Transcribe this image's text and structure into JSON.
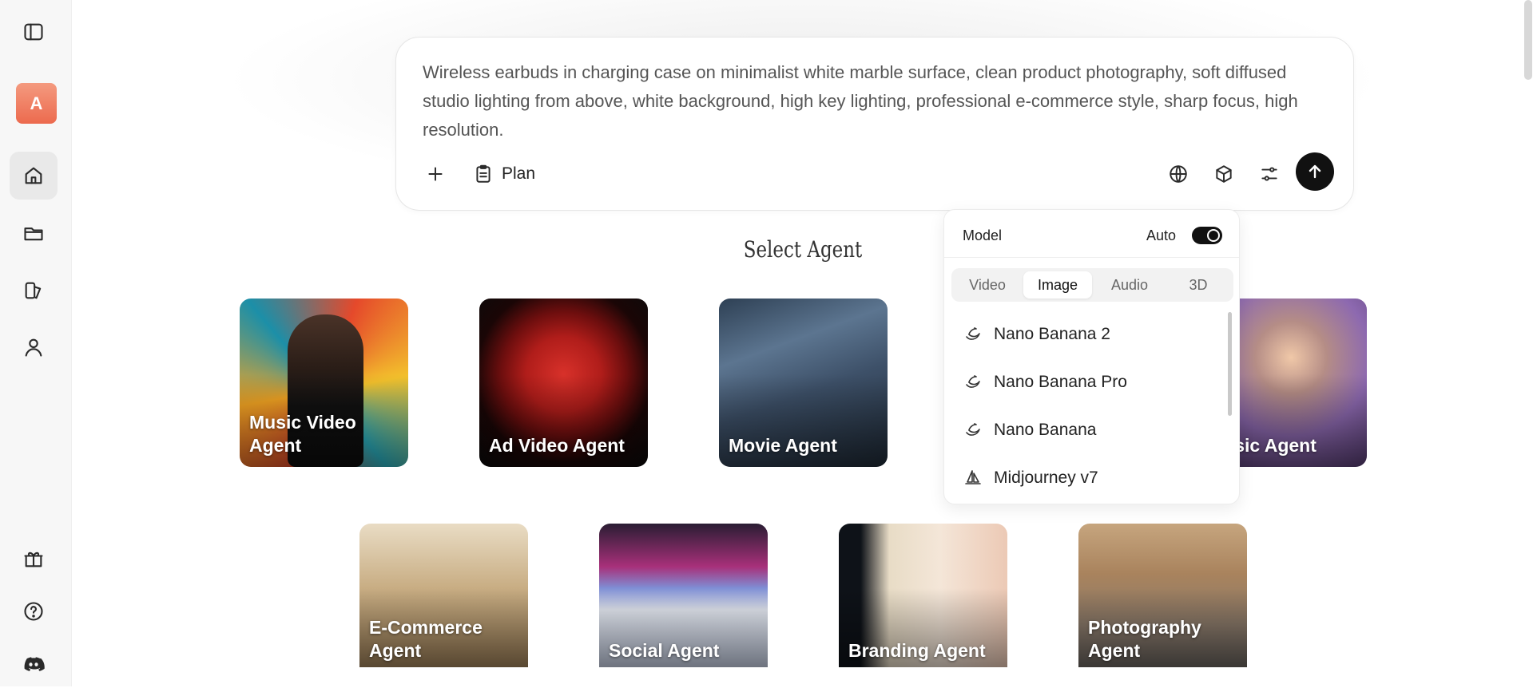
{
  "sidebar": {
    "avatar_letter": "A",
    "top_icons": [
      "sidebar-toggle-icon"
    ],
    "nav": [
      {
        "name": "home",
        "icon": "home-icon",
        "active": true
      },
      {
        "name": "projects",
        "icon": "folder-icon",
        "active": false
      },
      {
        "name": "library",
        "icon": "library-icon",
        "active": false
      },
      {
        "name": "profile",
        "icon": "user-icon",
        "active": false
      }
    ],
    "bottom_icons": [
      "gift-icon",
      "help-icon",
      "discord-icon"
    ]
  },
  "prompt": {
    "text": "Wireless earbuds in charging case on minimalist white marble surface, clean product photography, soft diffused studio lighting from above, white background, high key lighting, professional e-commerce style, sharp focus, high resolution.",
    "plan_label": "Plan"
  },
  "section_title": "Select Agent",
  "agents": {
    "music_video": "Music Video Agent",
    "ad_video": "Ad Video Agent",
    "movie": "Movie Agent",
    "music": "Music Agent",
    "ecommerce": "E-Commerce Agent",
    "social": "Social Agent",
    "branding": "Branding Agent",
    "photography": "Photography Agent"
  },
  "model_panel": {
    "title": "Model",
    "auto_label": "Auto",
    "auto_on": true,
    "tabs": [
      "Video",
      "Image",
      "Audio",
      "3D"
    ],
    "active_tab": "Image",
    "models": [
      "Nano Banana 2",
      "Nano Banana Pro",
      "Nano Banana",
      "Midjourney v7"
    ]
  },
  "colors": {
    "send_button": "#111111",
    "avatar": "#ec6a4e"
  }
}
